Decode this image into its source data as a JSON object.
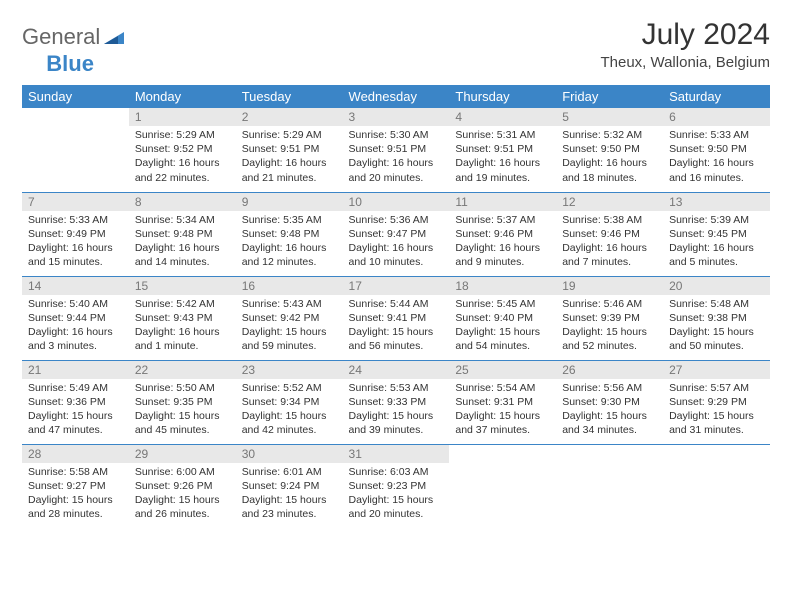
{
  "logo": {
    "part1": "General",
    "part2": "Blue"
  },
  "title": "July 2024",
  "location": "Theux, Wallonia, Belgium",
  "weekdays": [
    "Sunday",
    "Monday",
    "Tuesday",
    "Wednesday",
    "Thursday",
    "Friday",
    "Saturday"
  ],
  "weeks": [
    [
      null,
      {
        "n": "1",
        "sr": "5:29 AM",
        "ss": "9:52 PM",
        "dl": "16 hours and 22 minutes."
      },
      {
        "n": "2",
        "sr": "5:29 AM",
        "ss": "9:51 PM",
        "dl": "16 hours and 21 minutes."
      },
      {
        "n": "3",
        "sr": "5:30 AM",
        "ss": "9:51 PM",
        "dl": "16 hours and 20 minutes."
      },
      {
        "n": "4",
        "sr": "5:31 AM",
        "ss": "9:51 PM",
        "dl": "16 hours and 19 minutes."
      },
      {
        "n": "5",
        "sr": "5:32 AM",
        "ss": "9:50 PM",
        "dl": "16 hours and 18 minutes."
      },
      {
        "n": "6",
        "sr": "5:33 AM",
        "ss": "9:50 PM",
        "dl": "16 hours and 16 minutes."
      }
    ],
    [
      {
        "n": "7",
        "sr": "5:33 AM",
        "ss": "9:49 PM",
        "dl": "16 hours and 15 minutes."
      },
      {
        "n": "8",
        "sr": "5:34 AM",
        "ss": "9:48 PM",
        "dl": "16 hours and 14 minutes."
      },
      {
        "n": "9",
        "sr": "5:35 AM",
        "ss": "9:48 PM",
        "dl": "16 hours and 12 minutes."
      },
      {
        "n": "10",
        "sr": "5:36 AM",
        "ss": "9:47 PM",
        "dl": "16 hours and 10 minutes."
      },
      {
        "n": "11",
        "sr": "5:37 AM",
        "ss": "9:46 PM",
        "dl": "16 hours and 9 minutes."
      },
      {
        "n": "12",
        "sr": "5:38 AM",
        "ss": "9:46 PM",
        "dl": "16 hours and 7 minutes."
      },
      {
        "n": "13",
        "sr": "5:39 AM",
        "ss": "9:45 PM",
        "dl": "16 hours and 5 minutes."
      }
    ],
    [
      {
        "n": "14",
        "sr": "5:40 AM",
        "ss": "9:44 PM",
        "dl": "16 hours and 3 minutes."
      },
      {
        "n": "15",
        "sr": "5:42 AM",
        "ss": "9:43 PM",
        "dl": "16 hours and 1 minute."
      },
      {
        "n": "16",
        "sr": "5:43 AM",
        "ss": "9:42 PM",
        "dl": "15 hours and 59 minutes."
      },
      {
        "n": "17",
        "sr": "5:44 AM",
        "ss": "9:41 PM",
        "dl": "15 hours and 56 minutes."
      },
      {
        "n": "18",
        "sr": "5:45 AM",
        "ss": "9:40 PM",
        "dl": "15 hours and 54 minutes."
      },
      {
        "n": "19",
        "sr": "5:46 AM",
        "ss": "9:39 PM",
        "dl": "15 hours and 52 minutes."
      },
      {
        "n": "20",
        "sr": "5:48 AM",
        "ss": "9:38 PM",
        "dl": "15 hours and 50 minutes."
      }
    ],
    [
      {
        "n": "21",
        "sr": "5:49 AM",
        "ss": "9:36 PM",
        "dl": "15 hours and 47 minutes."
      },
      {
        "n": "22",
        "sr": "5:50 AM",
        "ss": "9:35 PM",
        "dl": "15 hours and 45 minutes."
      },
      {
        "n": "23",
        "sr": "5:52 AM",
        "ss": "9:34 PM",
        "dl": "15 hours and 42 minutes."
      },
      {
        "n": "24",
        "sr": "5:53 AM",
        "ss": "9:33 PM",
        "dl": "15 hours and 39 minutes."
      },
      {
        "n": "25",
        "sr": "5:54 AM",
        "ss": "9:31 PM",
        "dl": "15 hours and 37 minutes."
      },
      {
        "n": "26",
        "sr": "5:56 AM",
        "ss": "9:30 PM",
        "dl": "15 hours and 34 minutes."
      },
      {
        "n": "27",
        "sr": "5:57 AM",
        "ss": "9:29 PM",
        "dl": "15 hours and 31 minutes."
      }
    ],
    [
      {
        "n": "28",
        "sr": "5:58 AM",
        "ss": "9:27 PM",
        "dl": "15 hours and 28 minutes."
      },
      {
        "n": "29",
        "sr": "6:00 AM",
        "ss": "9:26 PM",
        "dl": "15 hours and 26 minutes."
      },
      {
        "n": "30",
        "sr": "6:01 AM",
        "ss": "9:24 PM",
        "dl": "15 hours and 23 minutes."
      },
      {
        "n": "31",
        "sr": "6:03 AM",
        "ss": "9:23 PM",
        "dl": "15 hours and 20 minutes."
      },
      null,
      null,
      null
    ]
  ],
  "labels": {
    "sunrise": "Sunrise:",
    "sunset": "Sunset:",
    "daylight": "Daylight:"
  }
}
